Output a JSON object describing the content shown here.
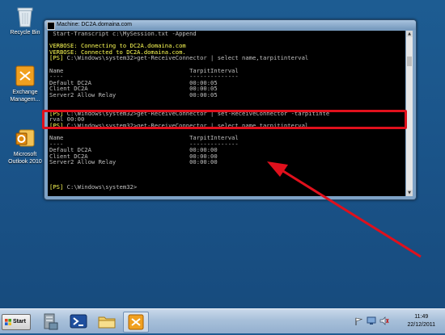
{
  "desktop": {
    "icons": [
      {
        "label": "Recycle Bin",
        "icon": "recycle-bin-icon"
      },
      {
        "label": "Exchange\nManagem...",
        "icon": "exchange-icon"
      },
      {
        "label": "Microsoft\nOutlook 2010",
        "icon": "outlook-icon"
      }
    ]
  },
  "window": {
    "title": "Machine: DC2A.domaina.com"
  },
  "console": {
    "lines": [
      {
        "text": " Start-Transcript c:\\MySession.txt -Append",
        "color": "white"
      },
      {
        "text": "",
        "color": "white"
      },
      {
        "text": "VERBOSE: Connecting to DC2A.domaina.com",
        "color": "yellow"
      },
      {
        "text": "VERBOSE: Connected to DC2A.domaina.com.",
        "color": "yellow"
      },
      {
        "text": "[PS] C:\\Windows\\system32>get-ReceiveConnector | select name,tarpitinterval",
        "color": "mixed"
      },
      {
        "text": "",
        "color": "white"
      },
      {
        "text": "Name                                    TarpitInterval",
        "color": "white"
      },
      {
        "text": "----                                    --------------",
        "color": "white"
      },
      {
        "text": "Default DC2A                            00:00:05",
        "color": "white"
      },
      {
        "text": "Client DC2A                             00:00:05",
        "color": "white"
      },
      {
        "text": "Server2 Allow Relay                     00:00:05",
        "color": "white"
      },
      {
        "text": "",
        "color": "white"
      },
      {
        "text": "",
        "color": "white"
      },
      {
        "text": "[PS] C:\\Windows\\system32>get-ReceiveConnector | set-ReceiveConnector -tarpitinte",
        "color": "mixed"
      },
      {
        "text": "rval 00:00",
        "color": "white"
      },
      {
        "text": "[PS] C:\\Windows\\system32>get-ReceiveConnector | select name,tarpitinterval",
        "color": "mixed"
      },
      {
        "text": "",
        "color": "white"
      },
      {
        "text": "Name                                    TarpitInterval",
        "color": "white"
      },
      {
        "text": "----                                    --------------",
        "color": "white"
      },
      {
        "text": "Default DC2A                            00:00:00",
        "color": "white"
      },
      {
        "text": "Client DC2A                             00:00:00",
        "color": "white"
      },
      {
        "text": "Server2 Allow Relay                     00:00:00",
        "color": "white"
      },
      {
        "text": "",
        "color": "white"
      },
      {
        "text": "",
        "color": "white"
      },
      {
        "text": "",
        "color": "white"
      },
      {
        "text": "[PS] C:\\Windows\\system32>",
        "color": "mixed"
      }
    ]
  },
  "taskbar": {
    "start_label": "Start",
    "pinned": [
      "server-manager-icon",
      "powershell-icon",
      "explorer-icon",
      "exchange-icon"
    ],
    "clock_time": "11:49",
    "clock_date": "22/12/2011"
  },
  "colors": {
    "highlight": "#e0101c",
    "console_bg": "#000000",
    "console_fg": "#c0c0c0",
    "verbose": "#ffff55",
    "desktop": "#1a5287"
  }
}
